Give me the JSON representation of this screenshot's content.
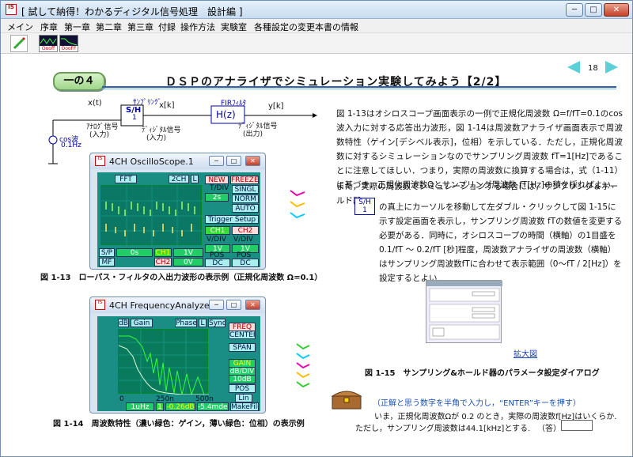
{
  "window": {
    "title": "[ 試して納得！わかるディジタル信号処理　設計編 ]",
    "controls": {
      "minimize": "─",
      "maximize": "□",
      "close": "✕"
    }
  },
  "menu": {
    "items": [
      "メイン",
      "序章",
      "第一章",
      "第二章",
      "第三章",
      "付録",
      "操作方法",
      "実験室",
      "各種設定の変更",
      "本書の情報"
    ]
  },
  "toolbar": {
    "btn1_label": "",
    "btn2_label": "Oooff",
    "btn3_label": "OooFF"
  },
  "page": {
    "section_badge": "一の４",
    "title": "ＤＳＰのアナライザでシミュレーション実験してみよう【2/2】",
    "page_number": "18"
  },
  "diagram": {
    "xt": "x(t)",
    "sampling": "ｻﾝﾌﾟﾘﾝｸﾞ",
    "xk": "x[k]",
    "sh": "S/H",
    "sh_num": "1",
    "fir": "FIRﾌｨﾙﾀ",
    "hz": "H(z)",
    "yk": "y[k]",
    "analog": "ｱﾅﾛｸﾞ信号",
    "analog_sub": "(入力)",
    "digital_in": "ﾃﾞｨｼﾞﾀﾙ信号",
    "digital_in_sub": "(入力)",
    "digital_out": "ﾃﾞｨｼﾞﾀﾙ信号",
    "digital_out_sub": "(出力)",
    "cos": "cos波",
    "freq": "0.1Hz"
  },
  "oscilloscope": {
    "title": "4CH OscilloScope.1",
    "fft": "FFT",
    "ch2": "2CH",
    "l": "L",
    "new": "NEW",
    "freeze": "FREEZE",
    "tdiv": "T/DIV",
    "tdiv_val": "2s",
    "singl": "SINGL",
    "norm": "NORM",
    "auto": "AUTO",
    "trigger": "Trigger Setup",
    "ch1": "CH1",
    "ch2b": "CH2",
    "vdiv1": "V/DIV",
    "vdiv2": "V/DIV",
    "v1": "1V",
    "v2": "1V",
    "pos1": "POS",
    "pos2": "POS",
    "dc1": "DC",
    "dc2": "DC",
    "sp": "S/P",
    "mf": "MF",
    "t0": "0s",
    "ch1v": "CH1",
    "ch1val": "1V",
    "ch2v": "CH2",
    "ch2val": "0V"
  },
  "analyzer": {
    "title": "4CH FrequencyAnalyzer.1",
    "db": "dB",
    "gain": "Gain",
    "phase": "Phase",
    "l": "L",
    "sync": "Sync",
    "freq": "FREQ",
    "center": "CENTER",
    "span": "SPAN",
    "gain_lbl": "GAIN",
    "dbdiv": "dB/DIV",
    "db10": "10dB",
    "pos": "POS",
    "lin": "Lin",
    "x0": "0",
    "x250": "250n",
    "x500": "500n",
    "f1": "1uHz",
    "one": "1",
    "f2": "-0.26dB",
    "f3": "-5.4mdeg",
    "make": "MakeFile"
  },
  "captions": {
    "fig13": "図 1-13　ローパス・フィルタの入出力波形の表示例（正規化周波数 Ω=0.1）",
    "fig14": "図 1-14　周波数特性（濃い緑色：ゲイン，薄い緑色：位相）の表示例",
    "fig15": "図 1-15　サンプリング&ホールド器のパラメータ設定ダイアログ"
  },
  "body": {
    "para1": "図 1-13はオシロスコープ画面表示の一例で正規化周波数 Ω=f/fT=0.1のcos波入力に対する応答出力波形，図 1-14は周波数アナライザ画面表示で周波数特性（ゲイン[デシベル表示]，位相）を示している．ただし，正規化周波数に対するシミュレーションなのでサンプリング周波数 fT=1[Hz]であることに注意してほしい．つまり，実際の周波数に換算する場合は，式（1-11）に基づき，正規化周波数Ωとサンプリング周波数 fT[Hz]の積を採ればよい．",
    "para2a": "また，実際の周波数でシミュレーションする場合には，サンプリング＆ホールド器",
    "para2b": "の真上にカーソルを移動して左ダブル・クリックして図 1-15に示す設定画面を表示し，サンプリング周波数 fTの数値を変更する必要がある．同時に，オシロスコープの時間（横軸）の1目盛を 0.1/fT ～ 0.2/fT [秒]程度，周波数アナライザの周波数（横軸）はサンプリング周波数fTに合わせて表示範囲（0～fT / 2[Hz]）を設定するとよい．",
    "sh_inline": "S/H",
    "sh_inline_num": "1"
  },
  "links": {
    "enlarge": "拡大図"
  },
  "quiz": {
    "instruction": "（正解と思う数字を半角で入力し，“ENTER”キーを押す）",
    "line1": "いま，正規化周波数Ωが 0.2 のとき，実際の周波数f[Hz]はいくらか.",
    "line2": "ただし，サンプリング周波数は44.1[kHz]とする.",
    "answer_label": "（答）",
    "answer_value": ""
  }
}
